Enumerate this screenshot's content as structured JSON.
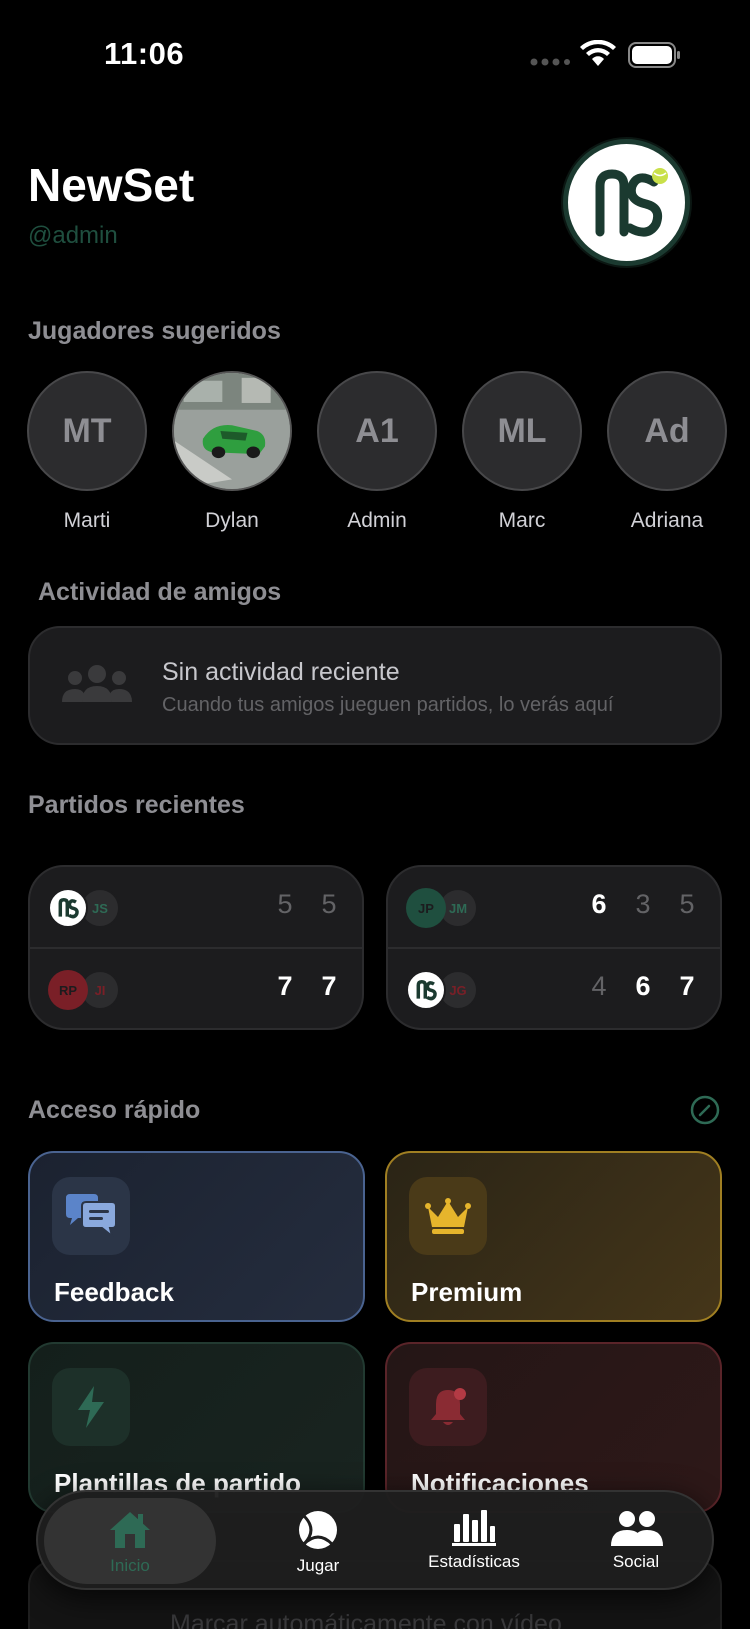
{
  "status_bar": {
    "time": "11:06"
  },
  "header": {
    "title": "NewSet",
    "username": "@admin"
  },
  "suggested_players": {
    "title": "Jugadores sugeridos",
    "items": [
      {
        "initials": "MT",
        "name": "Marti"
      },
      {
        "initials": "",
        "name": "Dylan"
      },
      {
        "initials": "A1",
        "name": "Admin"
      },
      {
        "initials": "ML",
        "name": "Marc"
      },
      {
        "initials": "Ad",
        "name": "Adriana"
      }
    ]
  },
  "friends_activity": {
    "title": "Actividad de amigos",
    "empty_title": "Sin actividad reciente",
    "empty_subtitle": "Cuando tus amigos jueguen partidos, lo verás aquí"
  },
  "recent_matches": {
    "title": "Partidos recientes",
    "items": [
      {
        "team1": {
          "players": [
            "",
            "JS"
          ],
          "scores": [
            "5",
            "5"
          ],
          "won": [
            false,
            false
          ]
        },
        "team2": {
          "players": [
            "RP",
            "JI"
          ],
          "scores": [
            "7",
            "7"
          ],
          "won": [
            true,
            true
          ]
        }
      },
      {
        "team1": {
          "players": [
            "JP",
            "JM"
          ],
          "scores": [
            "6",
            "3",
            "5"
          ],
          "won": [
            true,
            false,
            false
          ]
        },
        "team2": {
          "players": [
            "",
            "JG"
          ],
          "scores": [
            "4",
            "6",
            "7"
          ],
          "won": [
            false,
            true,
            true
          ]
        }
      }
    ]
  },
  "quick_access": {
    "title": "Acceso rápido",
    "items": [
      {
        "label": "Feedback",
        "icon": "chat-bubbles-icon"
      },
      {
        "label": "Premium",
        "icon": "crown-icon"
      },
      {
        "label": "Plantillas de partido",
        "icon": "lightning-icon"
      },
      {
        "label": "Notificaciones",
        "icon": "bell-icon"
      }
    ]
  },
  "below_fold": {
    "text": "Marcar automáticamente con vídeo"
  },
  "tab_bar": {
    "items": [
      {
        "label": "Inicio",
        "icon": "home-icon",
        "active": true
      },
      {
        "label": "Jugar",
        "icon": "tennis-ball-icon",
        "active": false
      },
      {
        "label": "Estadísticas",
        "icon": "bar-chart-icon",
        "active": false
      },
      {
        "label": "Social",
        "icon": "people-icon",
        "active": false
      }
    ]
  },
  "colors": {
    "accent_green": "#2e6a55",
    "premium_gold": "#a07f22",
    "feedback_blue": "#4a6390",
    "notifications_red": "#5a2429"
  }
}
